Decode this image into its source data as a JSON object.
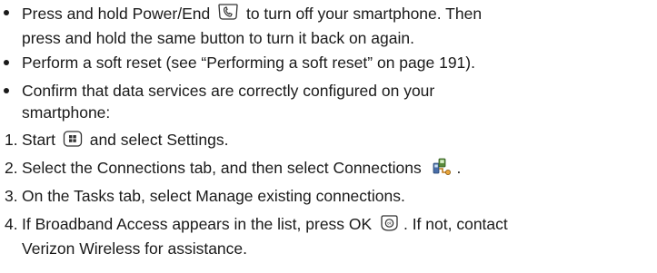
{
  "bullets": [
    {
      "before_icon": "Press and hold Power/End",
      "icon": "power-end-key-icon",
      "after_icon_line1": "to turn off your smartphone. Then",
      "line2": "press and hold the same button to turn it back on again."
    },
    {
      "text": "Perform a soft reset (see “Performing a soft reset” on page 191)."
    },
    {
      "line1": "Confirm that data services are correctly configured on your",
      "line2": "smartphone:"
    }
  ],
  "steps": [
    {
      "num": "1.",
      "before_icon": "Start",
      "icon": "start-key-icon",
      "after_icon": "and select Settings."
    },
    {
      "num": "2.",
      "before_icon": "Select the Connections tab, and then select Connections",
      "icon": "connections-icon",
      "after_icon": "."
    },
    {
      "num": "3.",
      "text": "On the Tasks tab, select Manage existing connections."
    },
    {
      "num": "4.",
      "before_icon": "If Broadband Access appears in the list, press OK",
      "icon": "ok-key-icon",
      "after_icon_line1": ". If not, contact",
      "line2": "Verizon Wireless for assistance."
    }
  ]
}
